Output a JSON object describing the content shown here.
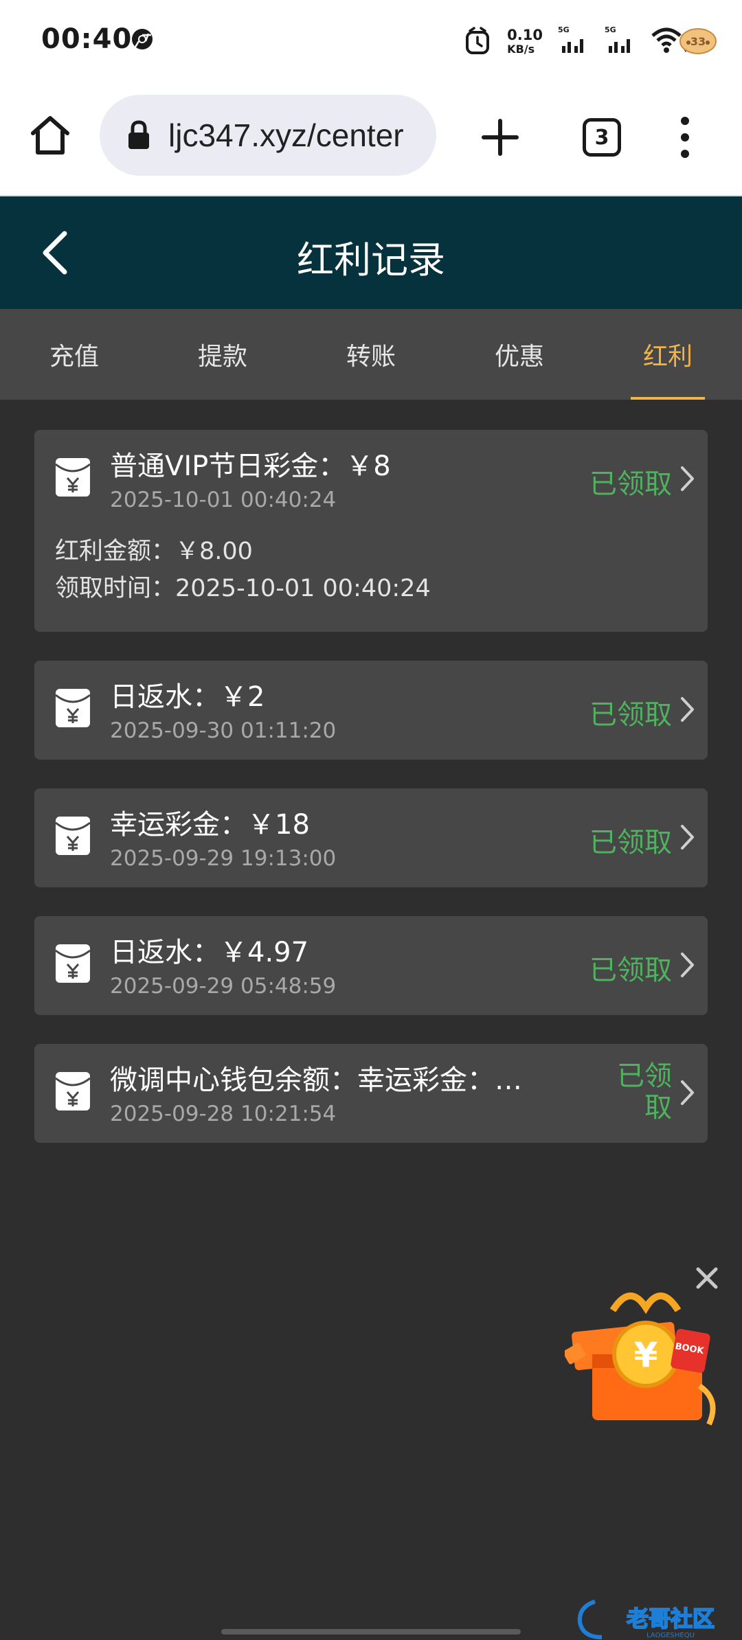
{
  "status_bar": {
    "time": "00:40",
    "net_speed": "0.10",
    "net_unit": "KB/s",
    "sim1_tag": "5G",
    "sim2_tag": "5G",
    "battery_badge": "33"
  },
  "browser": {
    "url": "ljc347.xyz/center",
    "tab_count": "3"
  },
  "header": {
    "title": "红利记录"
  },
  "tabs": [
    {
      "label": "充值",
      "active": false
    },
    {
      "label": "提款",
      "active": false
    },
    {
      "label": "转账",
      "active": false
    },
    {
      "label": "优惠",
      "active": false
    },
    {
      "label": "红利",
      "active": true
    }
  ],
  "records": [
    {
      "title": "普通VIP节日彩金：￥8",
      "date": "2025-10-01 00:40:24",
      "status": "已领取",
      "details": [
        "红利金额：￥8.00",
        "领取时间：2025-10-01 00:40:24"
      ]
    },
    {
      "title": "日返水：￥2",
      "date": "2025-09-30 01:11:20",
      "status": "已领取"
    },
    {
      "title": "幸运彩金：￥18",
      "date": "2025-09-29 19:13:00",
      "status": "已领取"
    },
    {
      "title": "日返水：￥4.97",
      "date": "2025-09-29 05:48:59",
      "status": "已领取"
    },
    {
      "title": "微调中心钱包余额：幸运彩金：…",
      "date": "2025-09-28 10:21:54",
      "status": "已领取"
    }
  ],
  "promo": {
    "gift_text": "BOOK"
  },
  "watermark": {
    "text": "老哥社区",
    "sub": "LAOGESHEQU"
  },
  "colors": {
    "header_bg": "#05323c",
    "page_bg": "#2e2e2e",
    "card_bg": "#474747",
    "tab_active": "#f2b347",
    "status_green": "#4fb25e"
  },
  "icons": {
    "record": "red-envelope-yen-icon",
    "status_arrow": "chevron-right-icon"
  }
}
